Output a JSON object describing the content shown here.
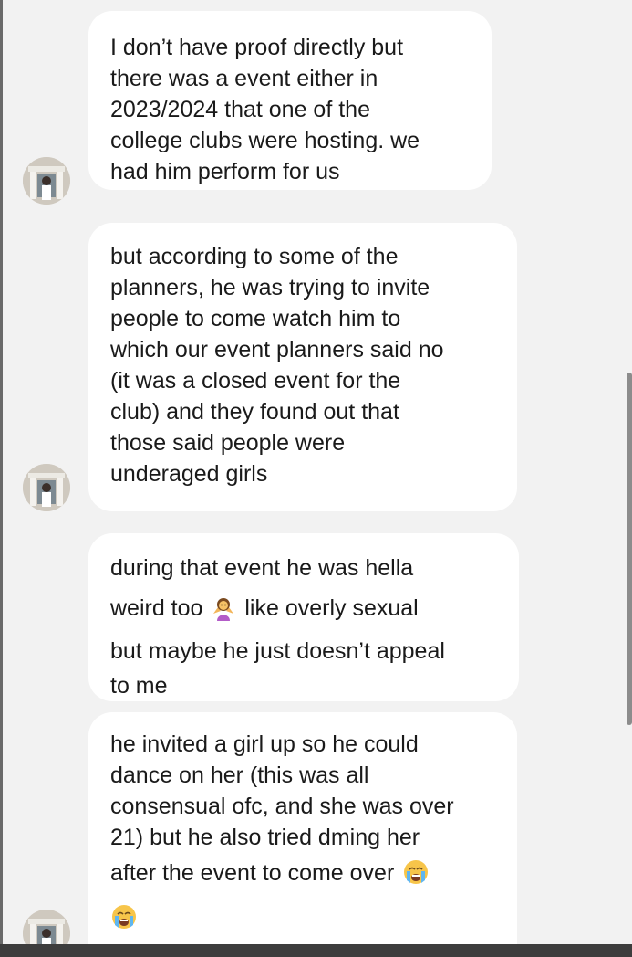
{
  "messages": [
    {
      "lines": [
        "I don’t have proof directly but",
        "there was a  event either in",
        "2023/2024 that one of the",
        "college clubs were hosting. we",
        "had him perform for us"
      ]
    },
    {
      "lines": [
        "but according to some of the",
        "planners, he was trying to invite",
        "people to come watch him to",
        "which our event planners said no",
        "(it was a closed event for the",
        "club) and they found out that",
        "those said people were",
        "underaged girls"
      ]
    },
    {
      "lines": [
        "during that event he was hella",
        "weird too",
        "like overly sexual",
        "but maybe he just doesn’t appeal",
        "to me"
      ],
      "emoji": "woman-shrugging-icon"
    },
    {
      "lines": [
        "he invited a girl up so he could",
        "dance on her (this was all",
        "consensual ofc, and she was over",
        "21) but he also tried dming her",
        "after the event to come over"
      ],
      "emojis": [
        "loudly-crying-face-icon",
        "loudly-crying-face-icon"
      ]
    }
  ],
  "colors": {
    "background": "#f2f2f2",
    "bubble": "#ffffff",
    "text": "#1a1a1a",
    "scrollbar": "#8c8c8c"
  }
}
